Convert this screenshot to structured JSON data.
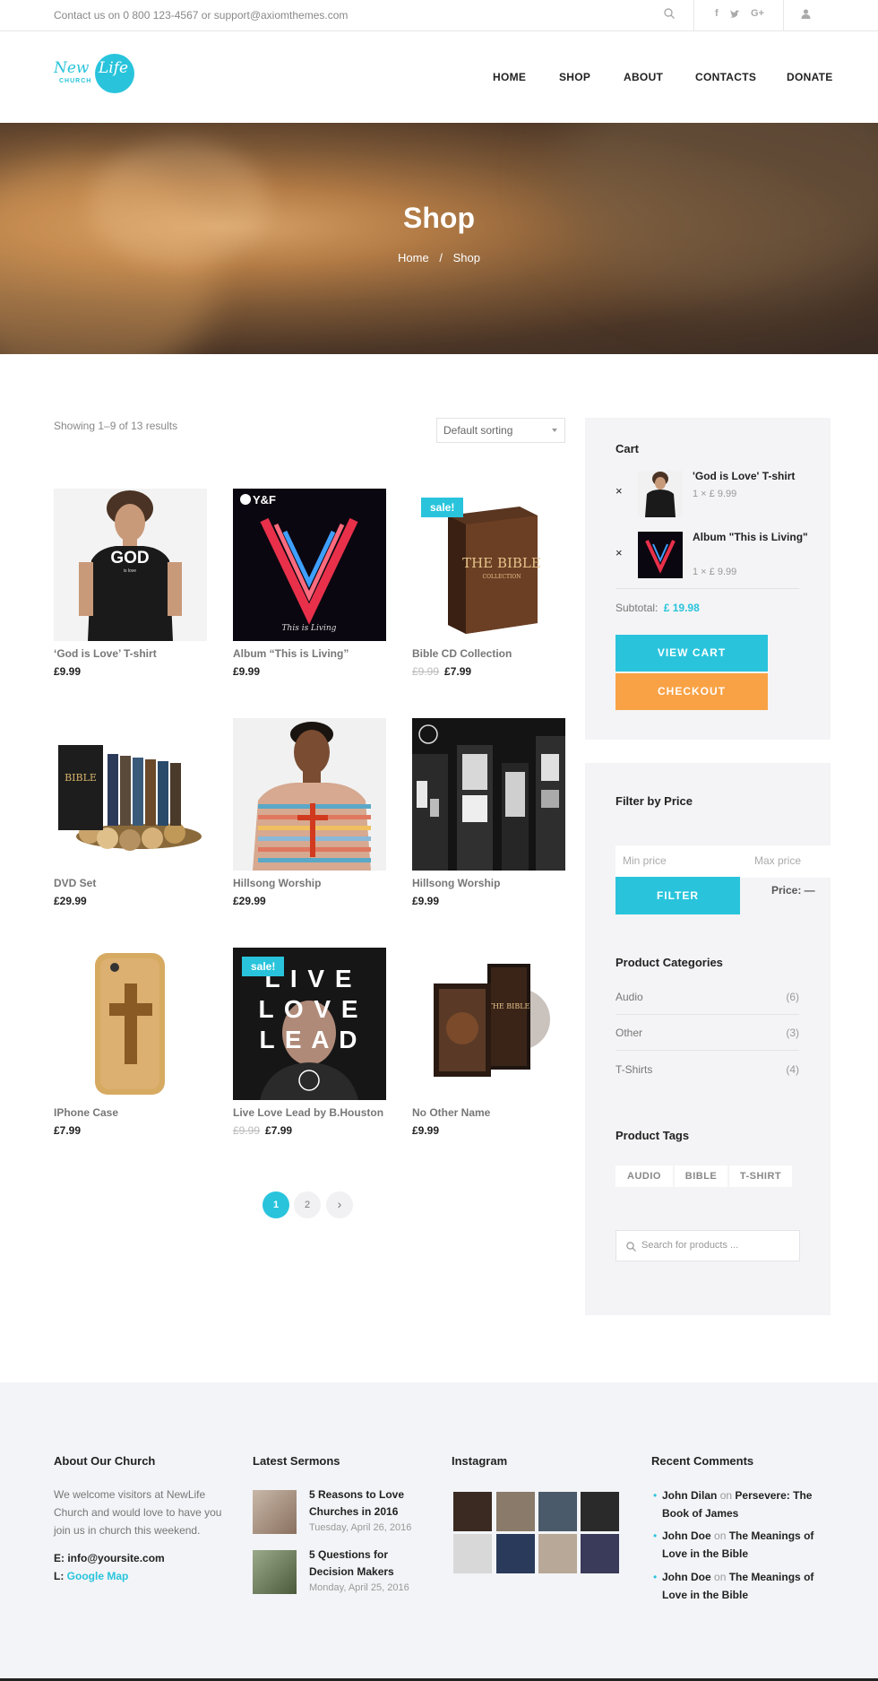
{
  "topbar": {
    "contact": "Contact us on 0 800 123-4567 or support@axiomthemes.com",
    "icons": [
      "search-icon",
      "facebook-icon",
      "twitter-icon",
      "google-plus-icon",
      "user-icon"
    ]
  },
  "header": {
    "logo_text_top": "New Life",
    "logo_text_bottom": "CHURCH",
    "nav": [
      "HOME",
      "SHOP",
      "ABOUT",
      "CONTACTS",
      "DONATE"
    ]
  },
  "hero": {
    "title": "Shop",
    "breadcrumb_home": "Home",
    "breadcrumb_sep": "/",
    "breadcrumb_current": "Shop"
  },
  "shop": {
    "showing": "Showing 1–9 of 13 results",
    "sort_selected": "Default sorting",
    "products": [
      {
        "name": "‘God is Love’ T-shirt",
        "price": "£9.99",
        "old_price": "",
        "sale": ""
      },
      {
        "name": "Album “This is Living”",
        "price": "£9.99",
        "old_price": "",
        "sale": ""
      },
      {
        "name": "Bible CD Collection",
        "price": "£7.99",
        "old_price": "£9.99",
        "sale": "sale!"
      },
      {
        "name": "DVD Set",
        "price": "£29.99",
        "old_price": "",
        "sale": ""
      },
      {
        "name": "Hillsong Worship",
        "price": "£29.99",
        "old_price": "",
        "sale": ""
      },
      {
        "name": "Hillsong Worship",
        "price": "£9.99",
        "old_price": "",
        "sale": ""
      },
      {
        "name": "IPhone Case",
        "price": "£7.99",
        "old_price": "",
        "sale": ""
      },
      {
        "name": "Live Love Lead by B.Houston",
        "price": "£7.99",
        "old_price": "£9.99",
        "sale": "sale!"
      },
      {
        "name": "No Other Name",
        "price": "£9.99",
        "old_price": "",
        "sale": ""
      }
    ],
    "image_text": {
      "tshirt": "GOD",
      "tshirt_small": "is love",
      "album_badge": "Y&F",
      "album_caption": "This is Living",
      "bible": "THE BIBLE",
      "bible_small": "COLLECTION",
      "dvd": "BIBLE",
      "live_love_lead_1": "L I V E",
      "live_love_lead_2": "L O V E",
      "live_love_lead_3": "L E A D",
      "no_other_name": "THE BIBLE"
    },
    "pagination": {
      "page1": "1",
      "page2": "2",
      "next": "›"
    }
  },
  "sidebar": {
    "cart": {
      "title": "Cart",
      "remove": "×",
      "items": [
        {
          "name": "'God is Love' T-shirt",
          "qty": "1 × £ 9.99"
        },
        {
          "name": "Album \"This is Living\"",
          "qty": "1 × £ 9.99"
        }
      ],
      "subtotal_label": "Subtotal:",
      "subtotal_value": "£ 19.98",
      "view_cart": "VIEW CART",
      "checkout": "CHECKOUT"
    },
    "filter": {
      "title": "Filter by Price",
      "min_placeholder": "Min price",
      "max_placeholder": "Max price",
      "button": "FILTER",
      "price_label": "Price: —"
    },
    "categories": {
      "title": "Product Categories",
      "items": [
        {
          "name": "Audio",
          "count": "(6)"
        },
        {
          "name": "Other",
          "count": "(3)"
        },
        {
          "name": "T-Shirts",
          "count": "(4)"
        }
      ]
    },
    "tags": {
      "title": "Product Tags",
      "items": [
        "AUDIO",
        "BIBLE",
        "T-SHIRT"
      ]
    },
    "search_placeholder": "Search for products ..."
  },
  "footer": {
    "about": {
      "title": "About Our Church",
      "text": "We welcome visitors at NewLife Church and would love to have you join us in church this weekend.",
      "email_label": "E:",
      "email": "info@yoursite.com",
      "location_label": "L:",
      "location_link": "Google Map"
    },
    "sermons": {
      "title": "Latest Sermons",
      "items": [
        {
          "title": "5 Reasons to Love Churches in 2016",
          "date": "Tuesday, April 26, 2016"
        },
        {
          "title": "5 Questions for Decision Makers",
          "date": "Monday, April 25, 2016"
        }
      ]
    },
    "instagram": {
      "title": "Instagram"
    },
    "comments": {
      "title": "Recent Comments",
      "on": "on",
      "items": [
        {
          "author": "John Dilan",
          "post": "Persevere: The Book of James"
        },
        {
          "author": "John Doe",
          "post": "The Meanings of Love in the Bible"
        },
        {
          "author": "John Doe",
          "post": "The Meanings of Love in the Bible"
        }
      ]
    }
  },
  "colors": {
    "accent": "#29c4dc",
    "checkout": "#f9a245",
    "sidebar_bg": "#f4f4f6",
    "footer_bg": "#f3f4f7"
  }
}
